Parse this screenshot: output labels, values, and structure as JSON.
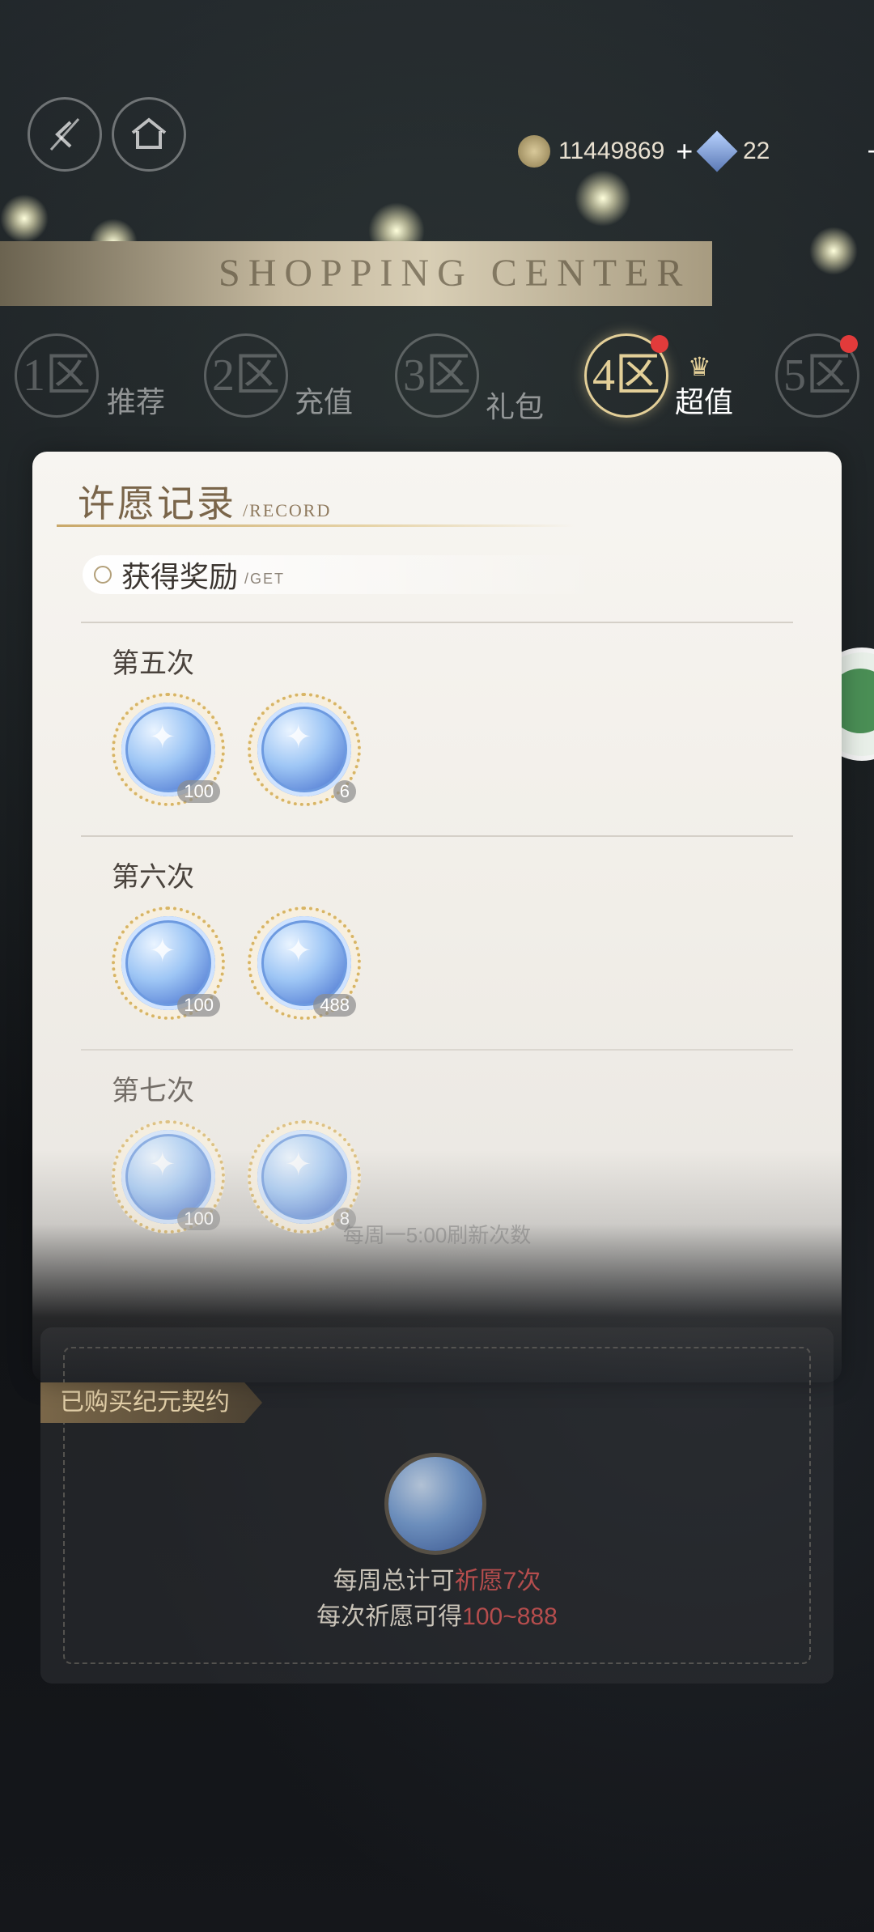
{
  "header": {
    "back_icon": "back-arrow-icon",
    "home_icon": "home-icon",
    "coins": "11449869",
    "gems": "22",
    "plus": "+"
  },
  "banner": {
    "text": "SHOPPING CENTER"
  },
  "zones": [
    {
      "num": "1区",
      "label": "推荐"
    },
    {
      "num": "2区",
      "label": "充值"
    },
    {
      "num": "3区",
      "label": "礼包"
    },
    {
      "num": "4区",
      "label": "超值"
    },
    {
      "num": "5区",
      "label": ""
    }
  ],
  "record": {
    "title": "许愿记录",
    "subtitle": "/RECORD",
    "get_label": "获得奖励",
    "get_sub": "/GET",
    "sections": [
      {
        "label": "第五次",
        "items": [
          {
            "count": "100"
          },
          {
            "count": "6"
          }
        ]
      },
      {
        "label": "第六次",
        "items": [
          {
            "count": "100"
          },
          {
            "count": "488"
          }
        ]
      },
      {
        "label": "第七次",
        "items": [
          {
            "count": "100"
          },
          {
            "count": "8"
          }
        ]
      }
    ]
  },
  "ghost": {
    "line1": "每周一5:00刷新次数"
  },
  "panel": {
    "tag": "已购买纪元契约",
    "line1_a": "每周总计可",
    "line1_b": "祈愿7次",
    "line2_a": "每次祈愿可得",
    "line2_b": "100~888"
  },
  "colors": {
    "accent": "#e3cf98",
    "highlight": "#b54d4d",
    "badge": "#e23b3b"
  }
}
